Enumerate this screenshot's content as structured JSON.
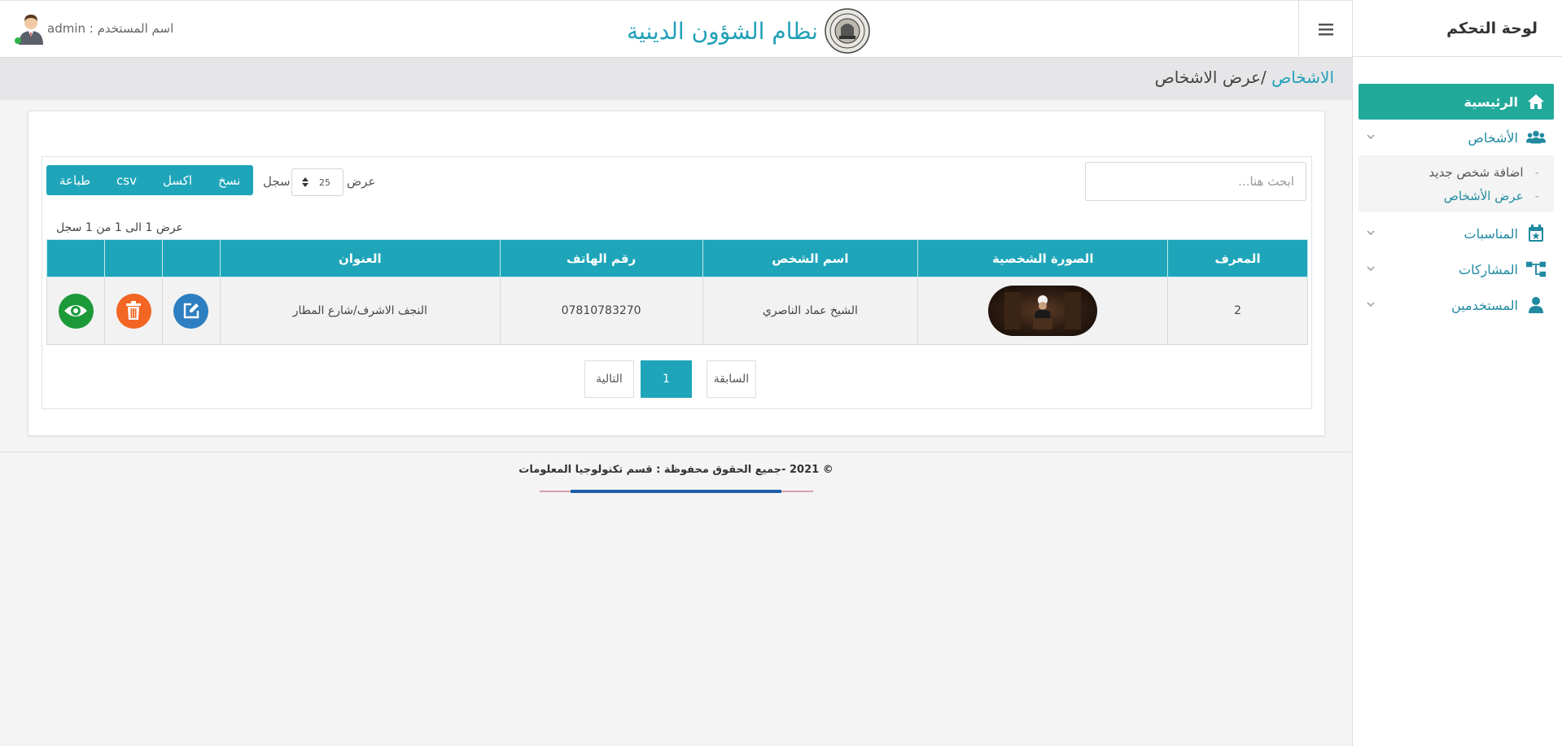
{
  "sidebar": {
    "brand": "لوحة التحكم",
    "items": [
      {
        "label": "الرئيسية",
        "icon": "home-icon"
      },
      {
        "label": "الأشخاص",
        "icon": "users-icon"
      },
      {
        "label": "المناسبات",
        "icon": "calendar-star-icon"
      },
      {
        "label": "المشاركات",
        "icon": "sitemap-icon"
      },
      {
        "label": "المستخدمين",
        "icon": "user-icon"
      }
    ],
    "submenu": [
      {
        "label": "اضافة شخص جديد"
      },
      {
        "label": "عرض الأشخاص"
      }
    ]
  },
  "header": {
    "title": "نظام الشؤون الدينية",
    "user_label": "اسم المستخدم : admin"
  },
  "breadcrumb": {
    "parent": "الاشخاص",
    "separator": " /",
    "current": "عرض الاشخاص"
  },
  "controls": {
    "search_placeholder": "ابحث هنا...",
    "show_label": "عرض",
    "page_length": "25",
    "records_label": "سجل",
    "buttons": {
      "copy": "نسخ",
      "excel": "اكسل",
      "csv": "csv",
      "print": "طباعة"
    },
    "info": "عرض 1 الى 1 من 1 سجل"
  },
  "table": {
    "headers": [
      "المعرف",
      "الصورة الشخصية",
      "اسم الشخص",
      "رقم الهاتف",
      "العنوان",
      "",
      "",
      ""
    ],
    "rows": [
      {
        "id": "2",
        "name": "الشيخ عماد الناصري",
        "phone": "07810783270",
        "address": "النجف الاشرف/شارع المطار"
      }
    ]
  },
  "pagination": {
    "prev": "السابقة",
    "current": "1",
    "next": "التالية"
  },
  "footer": {
    "text": "© 2021 -جميع الحقوق محفوظة : قسم تكنولوجيا المعلومات"
  },
  "colors": {
    "accent": "#1ea5b9",
    "active_menu": "#21a99a",
    "delete": "#f26522",
    "edit": "#2d7fc1",
    "view": "#1c9a3a"
  }
}
